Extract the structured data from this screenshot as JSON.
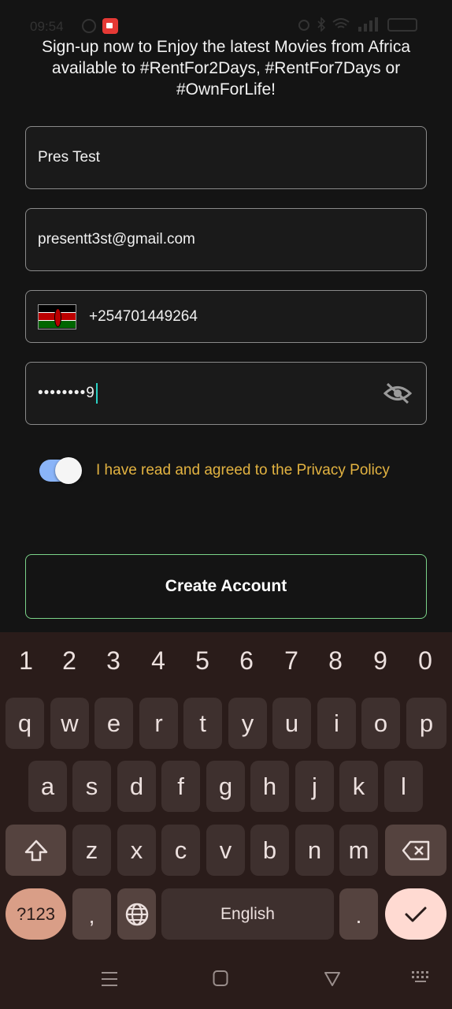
{
  "status_bar": {
    "time": "09:54"
  },
  "intro_text": "Sign-up now to Enjoy the latest Movies from Africa available to #RentFor2Days, #RentFor7Days or #OwnForLife!",
  "form": {
    "name_value": "Pres Test",
    "email_value": "presentt3st@gmail.com",
    "phone_value": "+254701449264",
    "password_value": "••••••••9"
  },
  "consent_text": "I have read and agreed to the Privacy Policy",
  "create_account_label": "Create Account",
  "keyboard": {
    "numbers": [
      "1",
      "2",
      "3",
      "4",
      "5",
      "6",
      "7",
      "8",
      "9",
      "0"
    ],
    "row1": [
      "q",
      "w",
      "e",
      "r",
      "t",
      "y",
      "u",
      "i",
      "o",
      "p"
    ],
    "row2": [
      "a",
      "s",
      "d",
      "f",
      "g",
      "h",
      "j",
      "k",
      "l"
    ],
    "row3": [
      "z",
      "x",
      "c",
      "v",
      "b",
      "n",
      "m"
    ],
    "symbols_label": "?123",
    "comma_label": ",",
    "space_label": "English",
    "period_label": "."
  },
  "colors": {
    "accent_yellow": "#e3b341",
    "button_border_green": "#7bd389",
    "toggle_on": "#8ab4f8",
    "cursor": "#2bd1c4"
  }
}
